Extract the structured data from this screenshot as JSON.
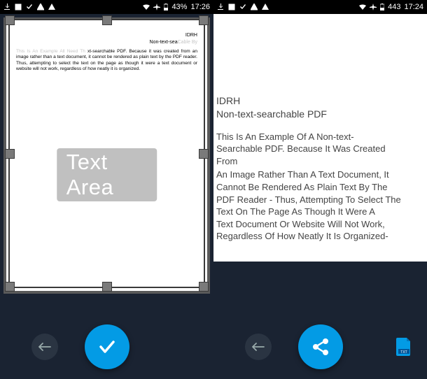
{
  "left": {
    "status": {
      "battery_pct": "43%",
      "time": "17:26"
    },
    "page": {
      "heading": "IDRH",
      "subheading_prefix": "Non-text-sea",
      "subheading_suffix": "Cable By",
      "title_dimmed": "This Is An Example All Need Th",
      "body": "xt-searchable PDF. Because it was created from an image rather than a text document, it cannot be rendered as plain text by the PDF reader. Thus, attempting to select the text on the page as though it were a text document or website will not work, regardless of how neatly it is organized.",
      "watermark": "Text Area"
    }
  },
  "right": {
    "status": {
      "battery_pct": "443",
      "time": "17:24"
    },
    "text": {
      "heading": "IDRH",
      "subheading": "Non-text-searchable PDF",
      "para1_line1": "This Is An Example Of A Non-text-",
      "para1_line2": "Searchable PDF. Because It Was Created",
      "para1_line3": "From",
      "para2_line1": "An Image Rather Than A Text Document, It",
      "para2_line2": "Cannot Be Rendered As Plain Text By The",
      "para2_line3": "PDF Reader - Thus, Attempting To Select The",
      "para2_line4": "Text On The Page As Though It Were A",
      "para2_line5": "Text Document Or Website Will Not Work,",
      "para2_line6": "Regardless Of How Neatly It Is Organized-"
    }
  },
  "icons": {
    "download": "download-icon",
    "image": "image-icon",
    "check": "check-icon",
    "warning": "warning-icon",
    "wifi": "wifi-icon",
    "airplane": "airplane-icon",
    "battery": "battery-icon"
  },
  "buttons": {
    "back": "back",
    "confirm": "confirm",
    "share": "share",
    "export_txt": "TXT"
  }
}
